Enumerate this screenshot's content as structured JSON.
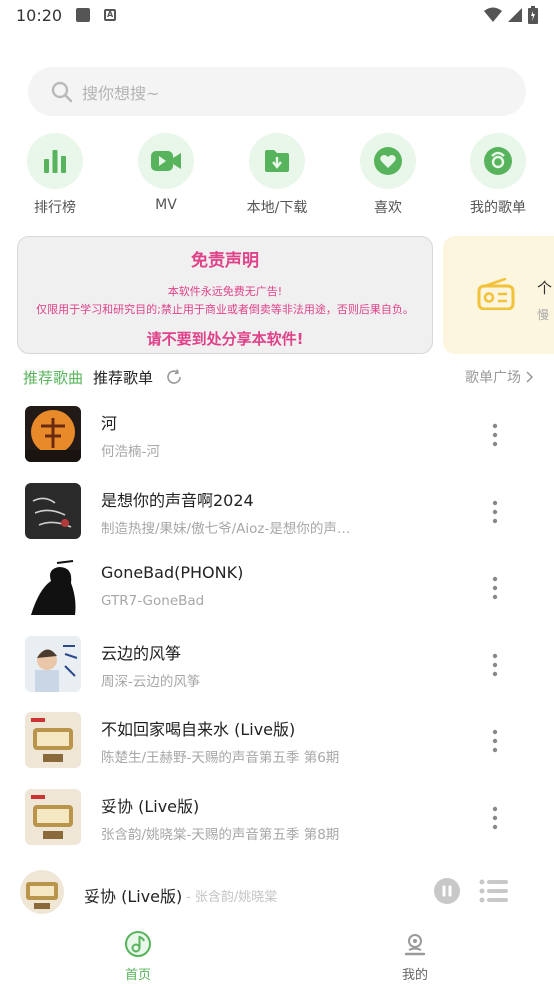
{
  "status_bar": {
    "time": "10:20"
  },
  "search": {
    "placeholder": "搜你想搜~"
  },
  "quick_nav": [
    {
      "label": "排行榜",
      "icon": "bar-chart-icon"
    },
    {
      "label": "MV",
      "icon": "video-camera-icon"
    },
    {
      "label": "本地/下载",
      "icon": "download-folder-icon"
    },
    {
      "label": "喜欢",
      "icon": "heart-icon"
    },
    {
      "label": "我的歌单",
      "icon": "disc-icon"
    }
  ],
  "banner": {
    "title": "免责声明",
    "line1": "本软件永远免费无广告!",
    "line2": "仅限用于学习和研究目的;禁止用于商业或者倒卖等非法用途，否则后果自负。",
    "footer": "请不要到处分享本软件!",
    "side_title": "个",
    "side_subtitle": "慢"
  },
  "section": {
    "tab_songs": "推荐歌曲",
    "tab_playlists": "推荐歌单",
    "playlist_square": "歌单广场"
  },
  "songs": [
    {
      "title": "河",
      "subtitle": "何浩楠-河"
    },
    {
      "title": "是想你的声音啊2024",
      "subtitle": "制造热搜/果妹/傲七爷/Aioz-是想你的声…"
    },
    {
      "title": "GoneBad(PHONK)",
      "subtitle": "GTR7-GoneBad"
    },
    {
      "title": "云边的风筝",
      "subtitle": "周深-云边的风筝"
    },
    {
      "title": "不如回家喝自来水 (Live版)",
      "subtitle": "陈楚生/王赫野-天赐的声音第五季 第6期"
    },
    {
      "title": "妥协 (Live版)",
      "subtitle": "张含韵/姚晓棠-天赐的声音第五季 第8期"
    }
  ],
  "player": {
    "title": "妥协 (Live版)",
    "artist": "- 张含韵/姚晓棠"
  },
  "bottom_nav": [
    {
      "label": "首页",
      "active": true
    },
    {
      "label": "我的",
      "active": false
    }
  ],
  "colors": {
    "accent": "#58b45c",
    "banner_pink": "#e0428a",
    "muted": "#a7a7a7"
  }
}
